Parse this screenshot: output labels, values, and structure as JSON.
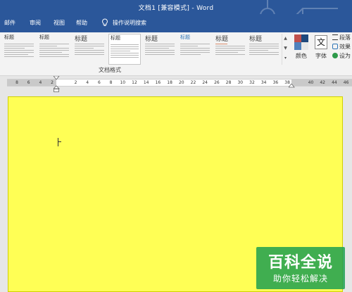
{
  "window": {
    "title": "文档1 [兼容模式] - Word"
  },
  "menu": {
    "tabs": [
      "邮件",
      "审阅",
      "视图",
      "帮助"
    ],
    "search": "操作说明搜索"
  },
  "ribbon": {
    "style_gallery": [
      {
        "name": "标题"
      },
      {
        "name": "标题"
      },
      {
        "name": "标题"
      },
      {
        "name": "标题"
      },
      {
        "name": "标题"
      },
      {
        "name": "标题"
      },
      {
        "name": "标题"
      },
      {
        "name": "标题"
      }
    ],
    "group_label": "文档格式",
    "colors_label": "颜色",
    "font_label": "字体",
    "font_glyph": "文",
    "paragraph_label": "段落",
    "effects_label": "效果",
    "set_default_label": "设为",
    "theme_colors": [
      "#c0504d",
      "#1f497d",
      "#4f81bd",
      "#f2f2f2"
    ]
  },
  "ruler": {
    "ticks": [
      "8",
      "6",
      "4",
      "2",
      "",
      "2",
      "4",
      "6",
      "8",
      "10",
      "12",
      "14",
      "16",
      "18",
      "20",
      "22",
      "24",
      "26",
      "28",
      "30",
      "32",
      "34",
      "36",
      "38",
      "",
      "40",
      "42",
      "44",
      "46",
      "48"
    ]
  },
  "document": {
    "page_color": "#ffff55"
  },
  "watermark": {
    "line1": "百科全说",
    "line2": "助你轻松解决"
  }
}
